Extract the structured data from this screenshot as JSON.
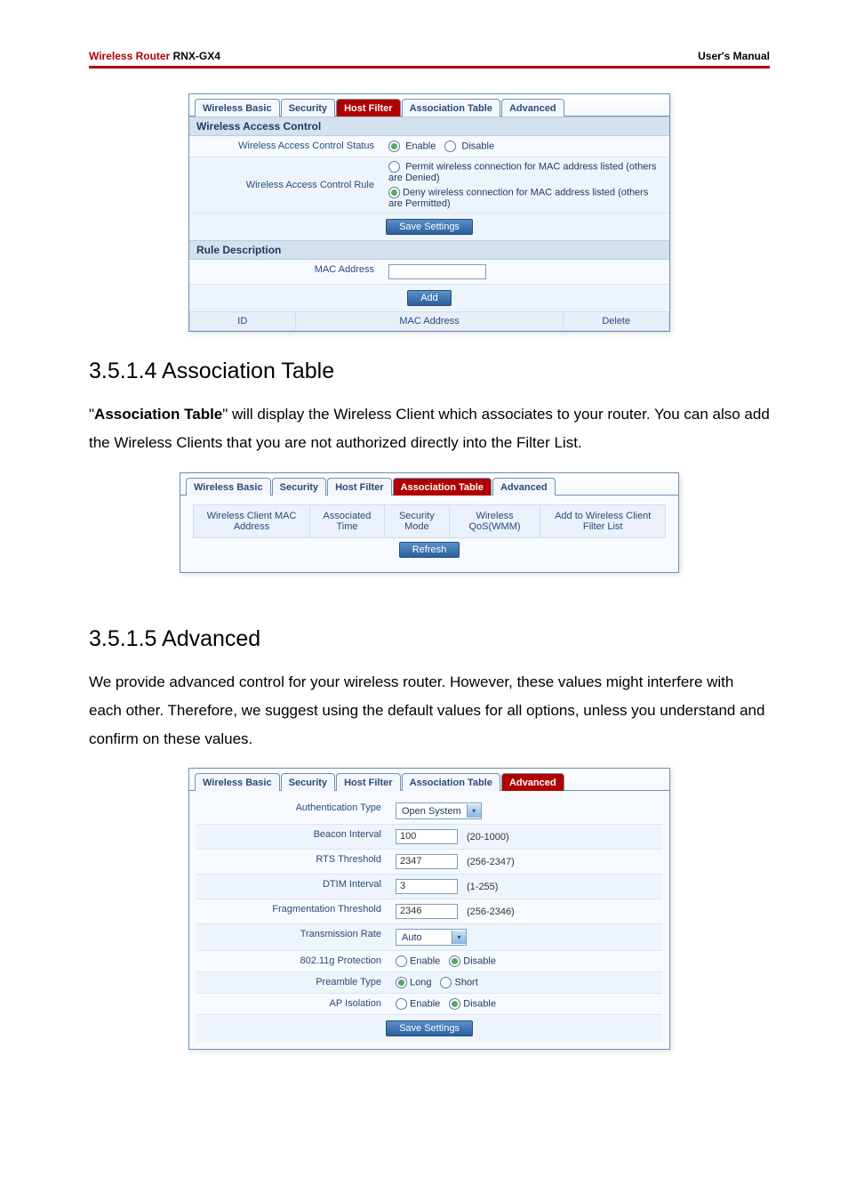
{
  "header": {
    "brand1": "Wireless Router",
    "brand2": " RNX-GX4",
    "manual": "User's Manual"
  },
  "panel1": {
    "tabs": [
      "Wireless Basic",
      "Security",
      "Host Filter",
      "Association Table",
      "Advanced"
    ],
    "active_index": 2,
    "section1_title": "Wireless Access Control",
    "row_status_label": "Wireless Access Control Status",
    "enable": "Enable",
    "disable": "Disable",
    "row_rule_label": "Wireless Access Control Rule",
    "permit": "Permit wireless connection for MAC address listed (others are Denied)",
    "deny": "Deny wireless connection for MAC address listed (others are Permitted)",
    "save": "Save Settings",
    "section2_title": "Rule Description",
    "mac_label": "MAC Address",
    "add": "Add",
    "cols": [
      "ID",
      "MAC Address",
      "Delete"
    ]
  },
  "h1": "3.5.1.4 Association Table",
  "p1a": "\"",
  "p1b": "Association Table",
  "p1c": "\" will display the Wireless Client which associates to your router. You can also add the Wireless Clients that you are not authorized directly into the Filter List.",
  "panel2": {
    "tabs": [
      "Wireless Basic",
      "Security",
      "Host Filter",
      "Association Table",
      "Advanced"
    ],
    "active_index": 3,
    "cols": [
      "Wireless Client MAC Address",
      "Associated Time",
      "Security Mode",
      "Wireless QoS(WMM)",
      "Add to Wireless Client Filter List"
    ],
    "refresh": "Refresh"
  },
  "h2": "3.5.1.5 Advanced",
  "p2": "We provide advanced control for your wireless router. However, these values might interfere with each other. Therefore, we suggest using the default values for all options, unless you understand and confirm on these values.",
  "panel3": {
    "tabs": [
      "Wireless Basic",
      "Security",
      "Host Filter",
      "Association Table",
      "Advanced"
    ],
    "active_index": 4,
    "rows": {
      "auth_type_label": "Authentication Type",
      "auth_type_value": "Open System",
      "beacon_label": "Beacon Interval",
      "beacon_value": "100",
      "beacon_range": "(20-1000)",
      "rts_label": "RTS Threshold",
      "rts_value": "2347",
      "rts_range": "(256-2347)",
      "dtim_label": "DTIM Interval",
      "dtim_value": "3",
      "dtim_range": "(1-255)",
      "frag_label": "Fragmentation Threshold",
      "frag_value": "2346",
      "frag_range": "(256-2346)",
      "tx_label": "Transmission Rate",
      "tx_value": "Auto",
      "gprot_label": "802.11g Protection",
      "preamble_label": "Preamble Type",
      "preamble_long": "Long",
      "preamble_short": "Short",
      "ap_label": "AP Isolation"
    },
    "enable": "Enable",
    "disable": "Disable",
    "save": "Save Settings"
  }
}
